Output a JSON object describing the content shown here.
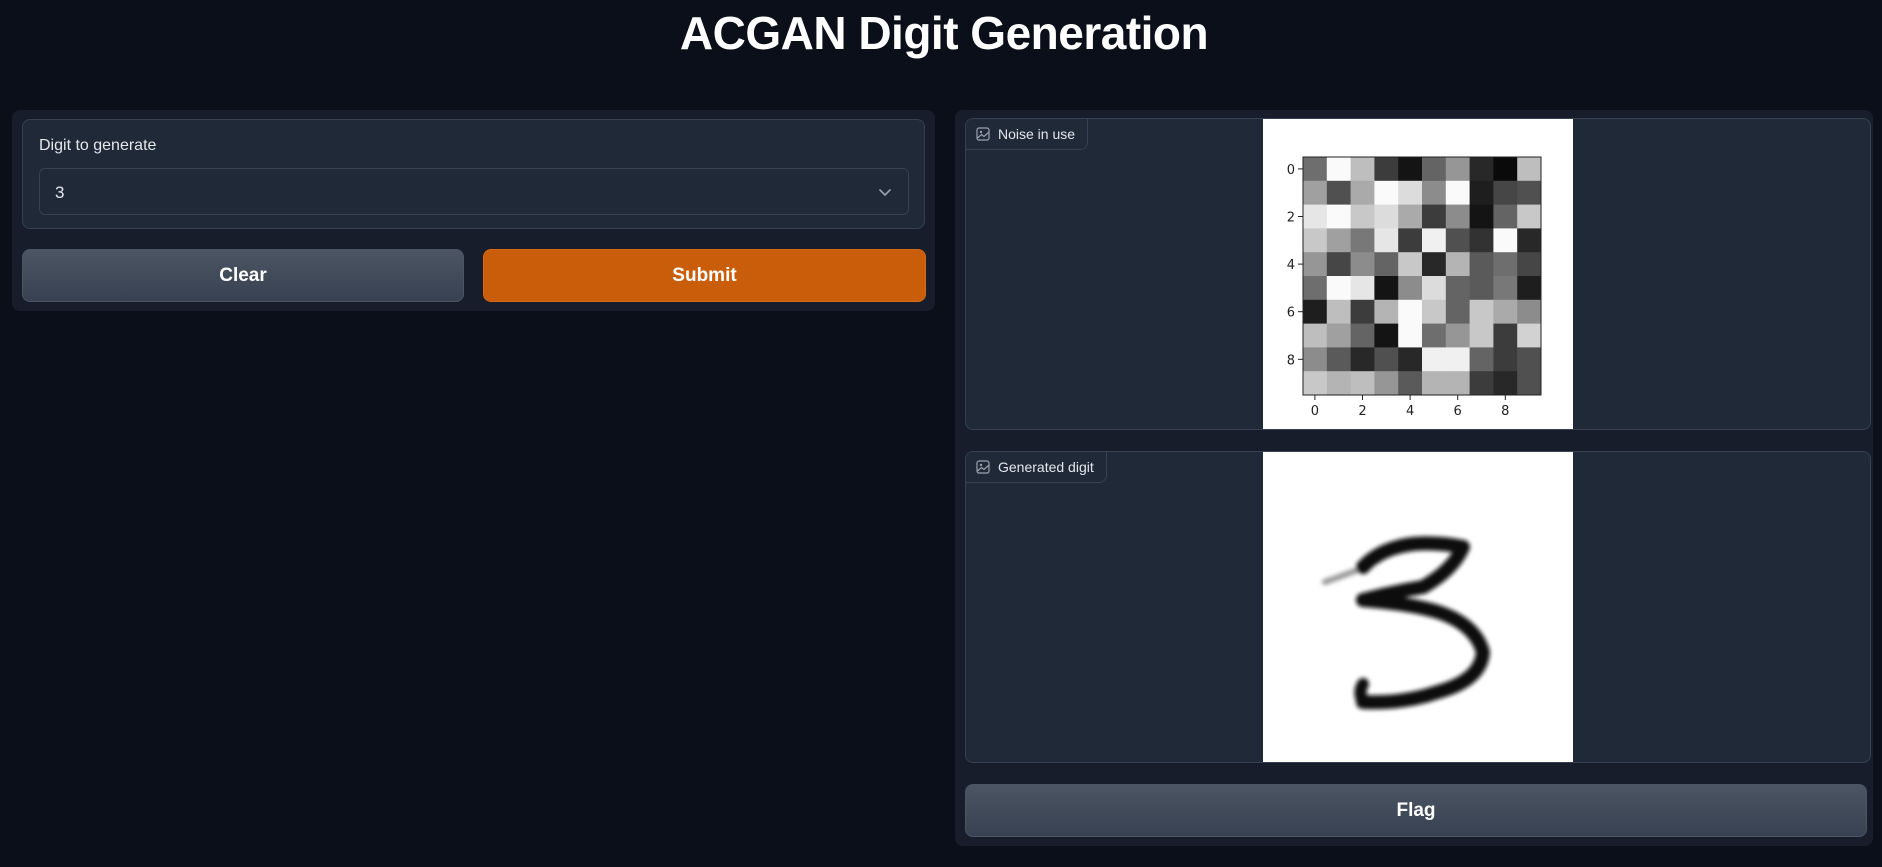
{
  "title": "ACGAN Digit Generation",
  "input": {
    "label": "Digit to generate",
    "selected": "3"
  },
  "buttons": {
    "clear": "Clear",
    "submit": "Submit",
    "flag": "Flag"
  },
  "outputs": {
    "noise_label": "Noise in use",
    "generated_label": "Generated digit"
  },
  "noise_plot": {
    "ticks": [
      "0",
      "2",
      "4",
      "6",
      "8"
    ],
    "grid": [
      [
        110,
        250,
        190,
        60,
        20,
        100,
        150,
        40,
        10,
        190
      ],
      [
        160,
        80,
        170,
        250,
        220,
        140,
        250,
        30,
        70,
        80
      ],
      [
        230,
        250,
        200,
        220,
        170,
        60,
        140,
        20,
        100,
        200
      ],
      [
        200,
        160,
        120,
        230,
        60,
        240,
        80,
        50,
        250,
        40
      ],
      [
        150,
        70,
        140,
        100,
        200,
        40,
        180,
        90,
        110,
        70
      ],
      [
        110,
        250,
        230,
        20,
        140,
        220,
        100,
        90,
        120,
        30
      ],
      [
        30,
        190,
        60,
        180,
        250,
        200,
        100,
        200,
        170,
        140
      ],
      [
        190,
        160,
        100,
        20,
        250,
        110,
        150,
        200,
        60,
        210
      ],
      [
        140,
        90,
        40,
        80,
        40,
        240,
        240,
        100,
        60,
        80
      ],
      [
        200,
        180,
        190,
        150,
        90,
        180,
        180,
        60,
        40,
        80
      ]
    ]
  },
  "colors": {
    "background": "#0b0f19",
    "panel": "#171d2b",
    "submit": "#c95d0a"
  }
}
